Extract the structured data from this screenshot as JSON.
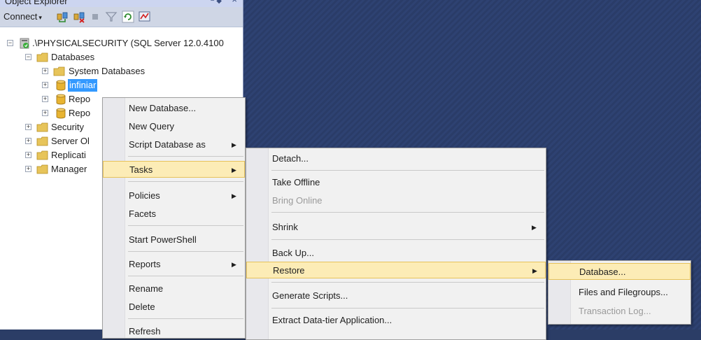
{
  "panel": {
    "title": "Object Explorer",
    "pin_glyph": "− ◆",
    "close_glyph": "×"
  },
  "toolbar": {
    "connect_label": "Connect",
    "connect_caret": "▾",
    "buttons": [
      "connect-object-explorer-icon",
      "disconnect-icon",
      "stop-icon",
      "filter-icon",
      "refresh-icon",
      "activity-monitor-icon"
    ]
  },
  "tree": {
    "server": ".\\PHYSICALSECURITY (SQL Server 12.0.4100",
    "databases": "Databases",
    "system_databases": "System Databases",
    "db_selected": "infiniar",
    "db_2": "Repo",
    "db_3": "Repo",
    "security": "Security",
    "server_objects": "Server Ol",
    "replication": "Replicati",
    "management": "Manager",
    "expand_glyph": "+",
    "collapse_glyph": "−"
  },
  "context_menu": {
    "new_database": "New Database...",
    "new_query": "New Query",
    "script_database_as": "Script Database as",
    "tasks": "Tasks",
    "policies": "Policies",
    "facets": "Facets",
    "start_powershell": "Start PowerShell",
    "reports": "Reports",
    "rename": "Rename",
    "delete": "Delete",
    "refresh": "Refresh",
    "arrow": "▶"
  },
  "tasks_menu": {
    "detach": "Detach...",
    "take_offline": "Take Offline",
    "bring_online": "Bring Online",
    "shrink": "Shrink",
    "back_up": "Back Up...",
    "restore": "Restore",
    "generate_scripts": "Generate Scripts...",
    "extract_data_tier": "Extract Data-tier Application..."
  },
  "restore_menu": {
    "database": "Database...",
    "files_and_filegroups": "Files and Filegroups...",
    "transaction_log": "Transaction Log..."
  },
  "colors": {
    "document_area": "#2b3d66",
    "hover_fill": "#fcecb6",
    "hover_border": "#e6c25a",
    "selection": "#3399ff",
    "menu_background": "#f1f1f1",
    "disabled_text": "#9a9a9a"
  }
}
